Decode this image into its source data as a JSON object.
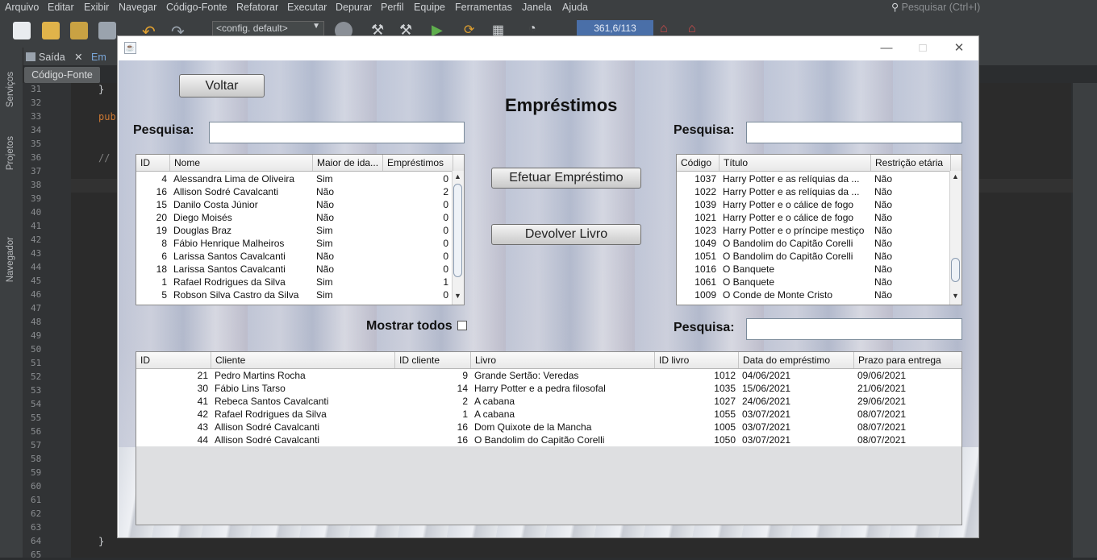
{
  "ide": {
    "menu": [
      "Arquivo",
      "Editar",
      "Exibir",
      "Navegar",
      "Código-Fonte",
      "Refatorar",
      "Executar",
      "Depurar",
      "Perfil",
      "Equipe",
      "Ferramentas",
      "Janela",
      "Ajuda"
    ],
    "search_placeholder": "Pesquisar (Ctrl+I)",
    "config": "<config. default>",
    "memory": "361,6/113",
    "tabs": {
      "output": "Saída",
      "other": "Em"
    },
    "subtab": "Código-Fonte",
    "sidebar": {
      "services": "Serviços",
      "projects": "Projetos",
      "navigator": "Navegador"
    },
    "line_numbers": [
      "31",
      "32",
      "33",
      "34",
      "35",
      "36",
      "37",
      "38",
      "39",
      "40",
      "41",
      "42",
      "43",
      "44",
      "45",
      "46",
      "47",
      "48",
      "49",
      "50",
      "51",
      "52",
      "53",
      "54",
      "55",
      "56",
      "57",
      "58",
      "59",
      "60",
      "61",
      "62",
      "63",
      "64",
      "65"
    ],
    "code": {
      "brace1": "}",
      "pub": "pub",
      "comment": "//",
      "brace2": "}"
    }
  },
  "window": {
    "title": "",
    "minimize": "—",
    "maximize": "□",
    "close": "✕"
  },
  "app": {
    "back_label": "Voltar",
    "heading": "Empréstimos",
    "search_label_clients": "Pesquisa:",
    "search_label_books": "Pesquisa:",
    "search_label_loans": "Pesquisa:",
    "lend_button": "Efetuar Empréstimo",
    "return_button": "Devolver Livro",
    "show_all_label": "Mostrar todos",
    "clients_table": {
      "columns": [
        "ID",
        "Nome",
        "Maior de ida...",
        "Empréstimos"
      ],
      "rows": [
        [
          "4",
          "Alessandra Lima de Oliveira",
          "Sim",
          "0"
        ],
        [
          "16",
          "Allison Sodré Cavalcanti",
          "Não",
          "2"
        ],
        [
          "15",
          "Danilo Costa Júnior",
          "Não",
          "0"
        ],
        [
          "20",
          "Diego Moisés",
          "Não",
          "0"
        ],
        [
          "19",
          "Douglas Braz",
          "Sim",
          "0"
        ],
        [
          "8",
          "Fábio Henrique Malheiros",
          "Sim",
          "0"
        ],
        [
          "6",
          "Larissa Santos Cavalcanti",
          "Não",
          "0"
        ],
        [
          "18",
          "Larissa Santos Cavalcanti",
          "Não",
          "0"
        ],
        [
          "1",
          "Rafael Rodrigues da Silva",
          "Sim",
          "1"
        ],
        [
          "5",
          "Robson Silva Castro da Silva",
          "Sim",
          "0"
        ]
      ]
    },
    "books_table": {
      "columns": [
        "Código",
        "Título",
        "Restrição etária"
      ],
      "rows": [
        [
          "1037",
          "Harry Potter e as relíquias da ...",
          "Não"
        ],
        [
          "1022",
          "Harry Potter e as relíquias da ...",
          "Não"
        ],
        [
          "1039",
          "Harry Potter e o cálice de fogo",
          "Não"
        ],
        [
          "1021",
          "Harry Potter e o cálice de fogo",
          "Não"
        ],
        [
          "1023",
          "Harry Potter e o príncipe mestiço",
          "Não"
        ],
        [
          "1049",
          "O Bandolim do Capitão Corelli",
          "Não"
        ],
        [
          "1051",
          "O Bandolim do Capitão Corelli",
          "Não"
        ],
        [
          "1016",
          "O Banquete",
          "Não"
        ],
        [
          "1061",
          "O Banquete",
          "Não"
        ],
        [
          "1009",
          "O Conde de Monte Cristo",
          "Não"
        ]
      ]
    },
    "loans_table": {
      "columns": [
        "ID",
        "Cliente",
        "ID cliente",
        "Livro",
        "ID livro",
        "Data do empréstimo",
        "Prazo para entrega"
      ],
      "rows": [
        [
          "21",
          "Pedro Martins Rocha",
          "9",
          "Grande Sertão: Veredas",
          "1012",
          "04/06/2021",
          "09/06/2021"
        ],
        [
          "30",
          "Fábio Lins Tarso",
          "14",
          "Harry Potter e a pedra filosofal",
          "1035",
          "15/06/2021",
          "21/06/2021"
        ],
        [
          "41",
          "Rebeca Santos Cavalcanti",
          "2",
          "A cabana",
          "1027",
          "24/06/2021",
          "29/06/2021"
        ],
        [
          "42",
          "Rafael Rodrigues da Silva",
          "1",
          "A cabana",
          "1055",
          "03/07/2021",
          "08/07/2021"
        ],
        [
          "43",
          "Allison Sodré Cavalcanti",
          "16",
          "Dom Quixote de la Mancha",
          "1005",
          "03/07/2021",
          "08/07/2021"
        ],
        [
          "44",
          "Allison Sodré Cavalcanti",
          "16",
          "O Bandolim do Capitão Corelli",
          "1050",
          "03/07/2021",
          "08/07/2021"
        ]
      ]
    }
  }
}
